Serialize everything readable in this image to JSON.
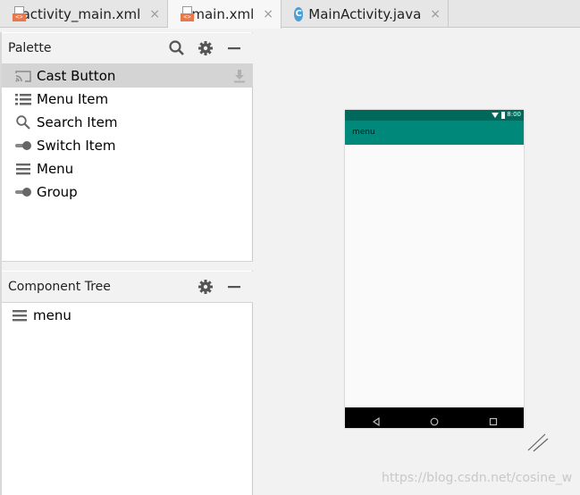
{
  "tabs": [
    {
      "label": "activity_main.xml",
      "icon": "xml-file-icon"
    },
    {
      "label": "main.xml",
      "icon": "xml-file-icon"
    },
    {
      "label": "MainActivity.java",
      "icon": "java-class-icon"
    }
  ],
  "xml_badge": "<>",
  "class_badge": "C",
  "close_glyph": "×",
  "palette": {
    "title": "Palette",
    "items": [
      {
        "label": "Cast Button",
        "icon": "cast-icon"
      },
      {
        "label": "Menu Item",
        "icon": "list-icon"
      },
      {
        "label": "Search Item",
        "icon": "search-icon"
      },
      {
        "label": "Switch Item",
        "icon": "switch-icon"
      },
      {
        "label": "Menu",
        "icon": "menu-icon"
      },
      {
        "label": "Group",
        "icon": "group-icon"
      }
    ]
  },
  "component_tree": {
    "title": "Component Tree",
    "root": {
      "label": "menu",
      "icon": "menu-icon"
    }
  },
  "preview": {
    "status_time": "8:00",
    "appbar_title": "menu",
    "colors": {
      "status": "#00695c",
      "appbar": "#00897b"
    }
  },
  "watermark": "https://blog.csdn.net/cosine_w"
}
